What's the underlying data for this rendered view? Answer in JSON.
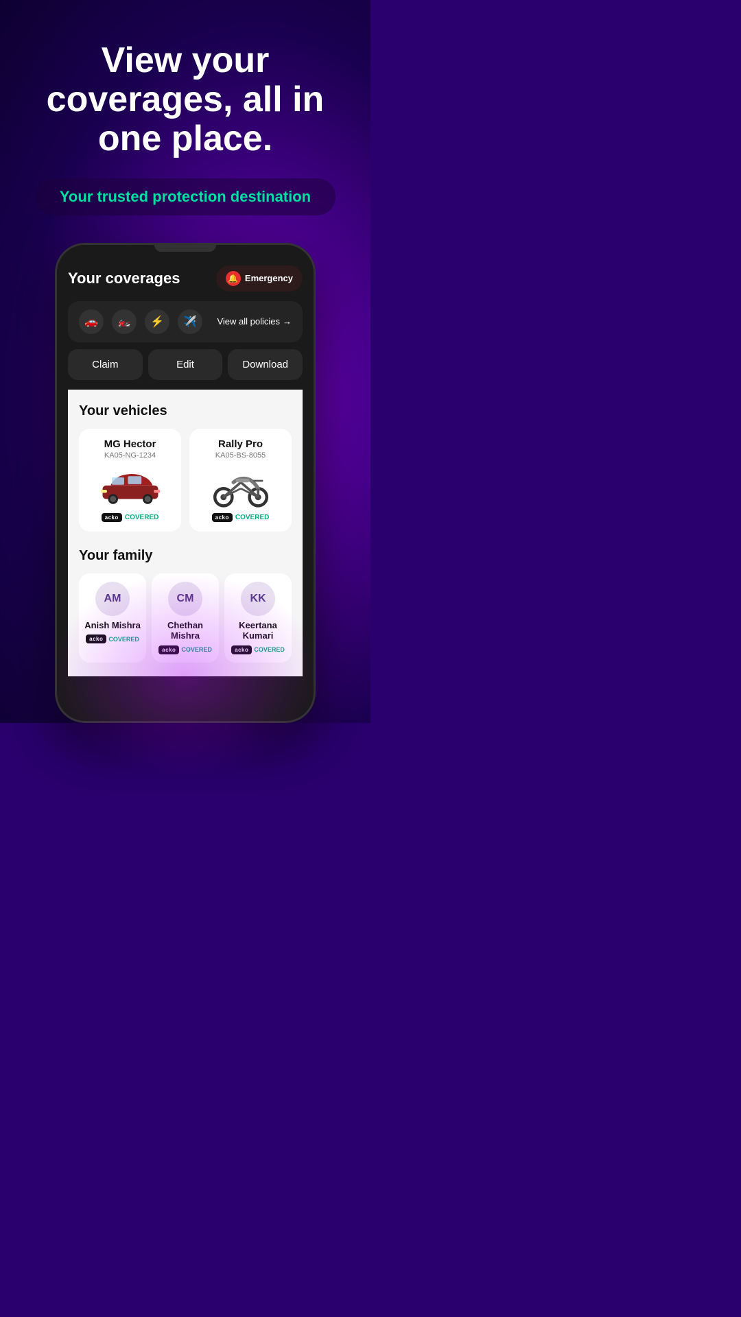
{
  "hero": {
    "title": "View your coverages, all in one place.",
    "subtitle": "Your trusted protection destination"
  },
  "app": {
    "screen_title": "Your coverages",
    "emergency_label": "Emergency",
    "view_all_label": "View all policies",
    "action_buttons": [
      "Claim",
      "Edit",
      "Download"
    ],
    "policy_icons": [
      "🚗",
      "🏍️",
      "⚡",
      "✈️"
    ]
  },
  "vehicles_section": {
    "title": "Your vehicles",
    "vehicles": [
      {
        "name": "MG Hector",
        "plate": "KA05-NG-1234",
        "type": "car",
        "status": "COVERED"
      },
      {
        "name": "Rally Pro",
        "plate": "KA05-BS-8055",
        "type": "bike",
        "status": "COVERED"
      }
    ]
  },
  "family_section": {
    "title": "Your family",
    "members": [
      {
        "initials": "AM",
        "name": "Anish Mishra",
        "status": "COVERED"
      },
      {
        "initials": "CM",
        "name": "Chethan Mishra",
        "status": "COVERED"
      },
      {
        "initials": "KK",
        "name": "Keertana Kumari",
        "status": "COVERED"
      }
    ]
  },
  "colors": {
    "brand_green": "#00e0a0",
    "covered_green": "#00b080",
    "emergency_red": "#e63030",
    "bg_purple": "#2a006e"
  }
}
